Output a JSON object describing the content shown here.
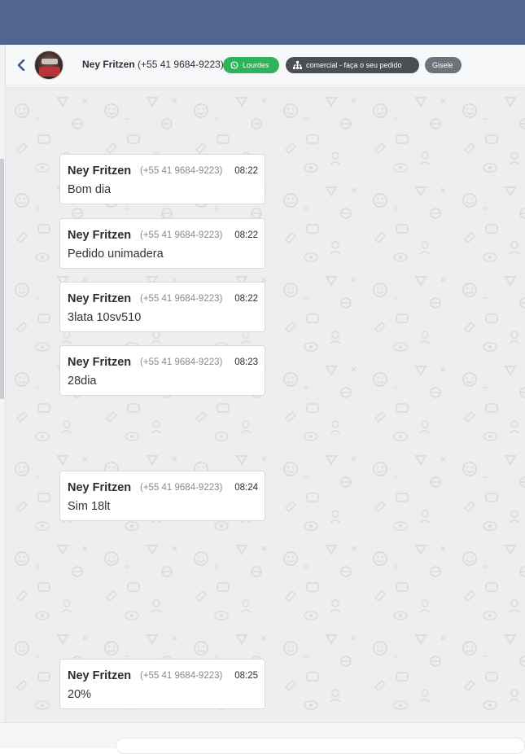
{
  "header": {
    "contact_name": "Ney Fritzen",
    "contact_phone": "(+55 41 9684-9223)",
    "back_icon": "chevron-left-icon",
    "tags": [
      {
        "label": "Lourdes",
        "icon": "whatsapp-icon",
        "color": "#2fb35a"
      },
      {
        "label": "comercial - faça o seu pedido",
        "icon": "sitemap-icon",
        "color": "#4b4f55"
      },
      {
        "label": "Gisele",
        "icon": "",
        "color": "#6c737b"
      }
    ]
  },
  "colors": {
    "topbar": "#51668e",
    "chat_background": "#eeeeee",
    "bubble": "#ffffff"
  },
  "messages": [
    {
      "sender": "Ney Fritzen",
      "phone": "(+55 41 9684-9223)",
      "time": "08:22",
      "text": "Bom dia"
    },
    {
      "sender": "Ney Fritzen",
      "phone": "(+55 41 9684-9223)",
      "time": "08:22",
      "text": "Pedido unimadera"
    },
    {
      "sender": "Ney Fritzen",
      "phone": "(+55 41 9684-9223)",
      "time": "08:22",
      "text": "3lata 10sv510"
    },
    {
      "sender": "Ney Fritzen",
      "phone": "(+55 41 9684-9223)",
      "time": "08:23",
      "text": "28dia"
    },
    {
      "sender": "Ney Fritzen",
      "phone": "(+55 41 9684-9223)",
      "time": "08:24",
      "text": "Sim 18lt"
    },
    {
      "sender": "Ney Fritzen",
      "phone": "(+55 41 9684-9223)",
      "time": "08:25",
      "text": "20%"
    }
  ]
}
